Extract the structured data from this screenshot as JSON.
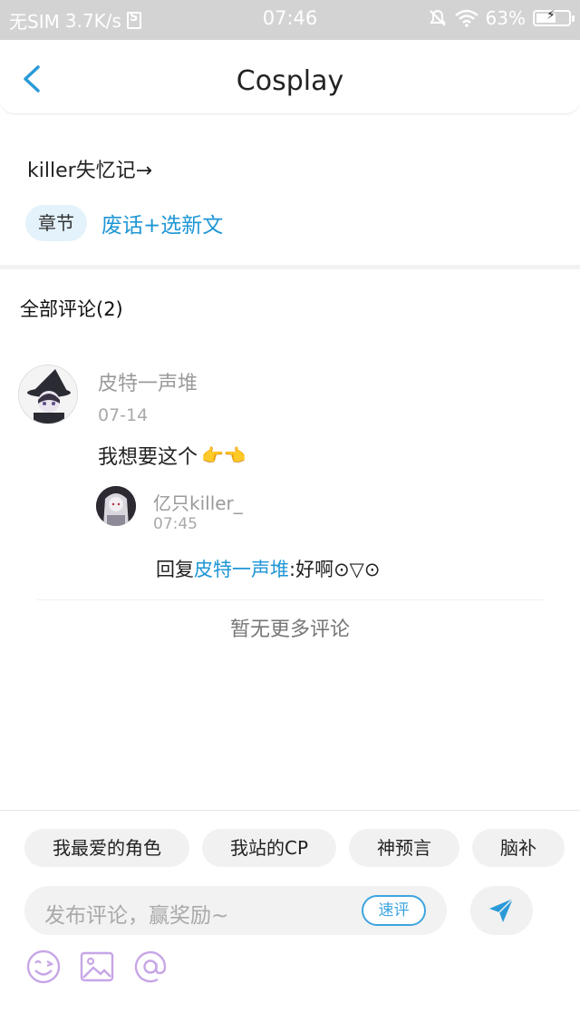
{
  "status_bar": {
    "sim": "无SIM",
    "speed": "3.7K/s",
    "time": "07:46",
    "battery": "63%",
    "battery_level": 0.63
  },
  "header": {
    "title": "Cosplay"
  },
  "post": {
    "title": "killer失忆记→",
    "chapter_tag": "章节",
    "chapter_name": "废话+选新文"
  },
  "comments": {
    "heading": "全部评论(2)",
    "items": [
      {
        "user": "皮特一声堆",
        "date": "07-14",
        "text": "我想要这个",
        "emoji": "👉👈",
        "reply": {
          "user": "亿只killer_",
          "date": "07:45",
          "prefix": "回复",
          "mention": "皮特一声堆",
          "text": ":好啊⊙▽⊙"
        }
      }
    ],
    "no_more": "暂无更多评论"
  },
  "composer": {
    "chips": [
      "我最爱的角色",
      "我站的CP",
      "神预言",
      "脑补"
    ],
    "placeholder": "发布评论，赢奖励~",
    "quick_review": "速评"
  },
  "colors": {
    "accent": "#1e96d5",
    "chapter_tag_bg": "#e3f2fb",
    "tool_icon": "#c7a6e6",
    "status_bar_bg": "#d3d3d3"
  },
  "icons": [
    "back-icon",
    "mute-icon",
    "wifi-icon",
    "battery-icon",
    "send-icon",
    "emoji-icon",
    "image-icon",
    "at-icon"
  ]
}
